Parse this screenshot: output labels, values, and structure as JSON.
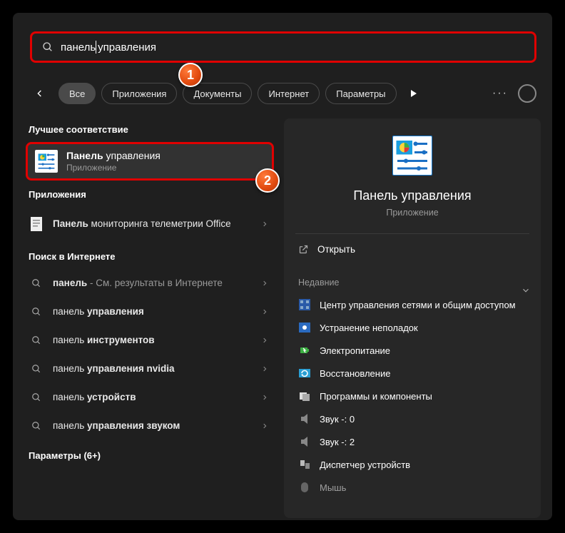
{
  "search": {
    "query_part1": "панель",
    "query_part2": "управления"
  },
  "badges": {
    "one": "1",
    "two": "2"
  },
  "tabs": {
    "all": "Все",
    "apps": "Приложения",
    "docs": "Документы",
    "web": "Интернет",
    "params": "Параметры"
  },
  "left": {
    "best_header": "Лучшее соответствие",
    "best_title_bold": "Панель",
    "best_title_rest": " управления",
    "best_sub": "Приложение",
    "apps_header": "Приложения",
    "app1_bold": "Панель",
    "app1_rest": " мониторинга телеметрии Office",
    "web_header": "Поиск в Интернете",
    "w1_bold": "панель",
    "w1_rest": " - См. результаты в Интернете",
    "w2_pre": "панель ",
    "w2_bold": "управления",
    "w3_pre": "панель ",
    "w3_bold": "инструментов",
    "w4_pre": "панель ",
    "w4_bold": "управления nvidia",
    "w5_pre": "панель ",
    "w5_bold": "устройств",
    "w6_pre": "панель ",
    "w6_bold": "управления звуком",
    "params_header": "Параметры (6+)"
  },
  "right": {
    "title": "Панель управления",
    "sub": "Приложение",
    "open": "Открыть",
    "recent_header": "Недавние",
    "items": [
      "Центр управления сетями и общим доступом",
      "Устранение неполадок",
      "Электропитание",
      "Восстановление",
      "Программы и компоненты",
      "Звук -: 0",
      "Звук -: 2",
      "Диспетчер устройств",
      "Мышь"
    ]
  }
}
